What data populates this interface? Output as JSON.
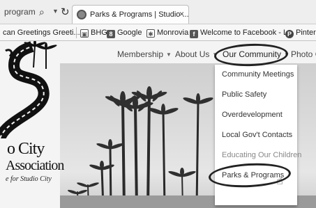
{
  "browser": {
    "address_fragment": "program",
    "tab": {
      "title": "Parks & Programs | Studio ...",
      "close": "×"
    }
  },
  "bookmarks": [
    {
      "label": "can Greetings Greeti...",
      "icon": ""
    },
    {
      "label": "BHG",
      "icon": "bhg-icon"
    },
    {
      "label": "Google",
      "icon": "google-icon"
    },
    {
      "label": "Monrovia",
      "icon": "monrovia-icon"
    },
    {
      "label": "Welcome to Facebook - L...",
      "icon": "facebook-icon"
    },
    {
      "label": "Pinter",
      "icon": "pinterest-icon"
    }
  ],
  "logo": {
    "line1": "o City",
    "line2": "Association",
    "tagline": "e for Studio City"
  },
  "nav": {
    "membership": "Membership",
    "about": "About Us",
    "community": "Our Community",
    "photo": "Photo G"
  },
  "dropdown": {
    "items": [
      "Community Meetings",
      "Public Safety",
      "Overdevelopment",
      "Local Gov't Contacts",
      "Educating Our Children",
      "Parks & Programs"
    ]
  },
  "colors": {
    "page_background": "#f4f4f4",
    "annotation_ink": "#222222",
    "dropdown_background": "#ffffff"
  }
}
